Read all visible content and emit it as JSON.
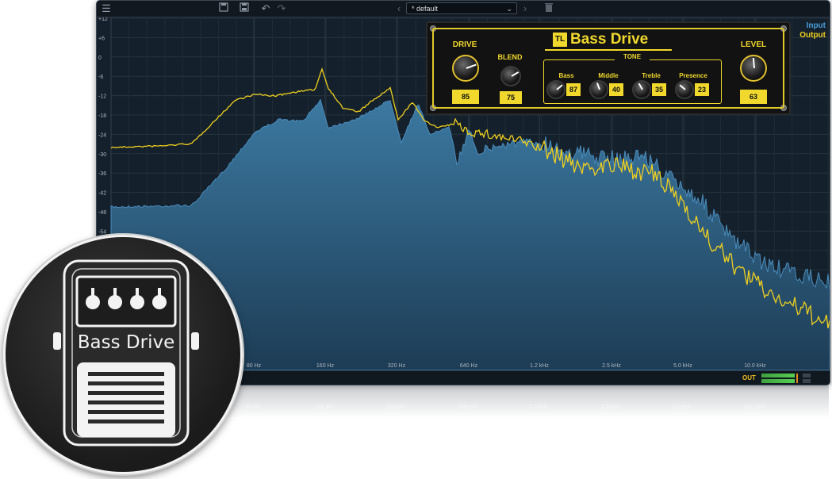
{
  "toolbar": {
    "preset_name": "* default",
    "icons": [
      "menu-icon",
      "save-icon",
      "save-as-icon",
      "undo-icon",
      "redo-icon",
      "prev-preset-icon",
      "dropdown-icon",
      "next-preset-icon",
      "trash-icon"
    ]
  },
  "legend": {
    "input": "Input",
    "output": "Output",
    "input_color": "#4a9fd8",
    "output_color": "#f0d020"
  },
  "axes": {
    "y_labels": [
      "+12",
      "+6",
      "0",
      "-6",
      "-12",
      "-18",
      "-24",
      "-30",
      "-36",
      "-42",
      "-48",
      "-54"
    ],
    "x_labels": [
      "80 Hz",
      "160 Hz",
      "320 Hz",
      "640 Hz",
      "1.2 kHz",
      "2.5 kHz",
      "5.0 kHz",
      "10.0 kHz"
    ]
  },
  "meters": {
    "out_label": "OUT"
  },
  "pedal": {
    "title": "Bass Drive",
    "logo": "TL",
    "tone_label": "TONE",
    "accent": "#f0d82c",
    "knobs": [
      {
        "label": "DRIVE",
        "value": "85"
      },
      {
        "label": "BLEND",
        "value": "75"
      },
      {
        "label": "Bass",
        "value": "87"
      },
      {
        "label": "Middle",
        "value": "40"
      },
      {
        "label": "Treble",
        "value": "35"
      },
      {
        "label": "Presence",
        "value": "23"
      },
      {
        "label": "LEVEL",
        "value": "63"
      }
    ]
  },
  "badge": {
    "title": "Bass Drive"
  }
}
